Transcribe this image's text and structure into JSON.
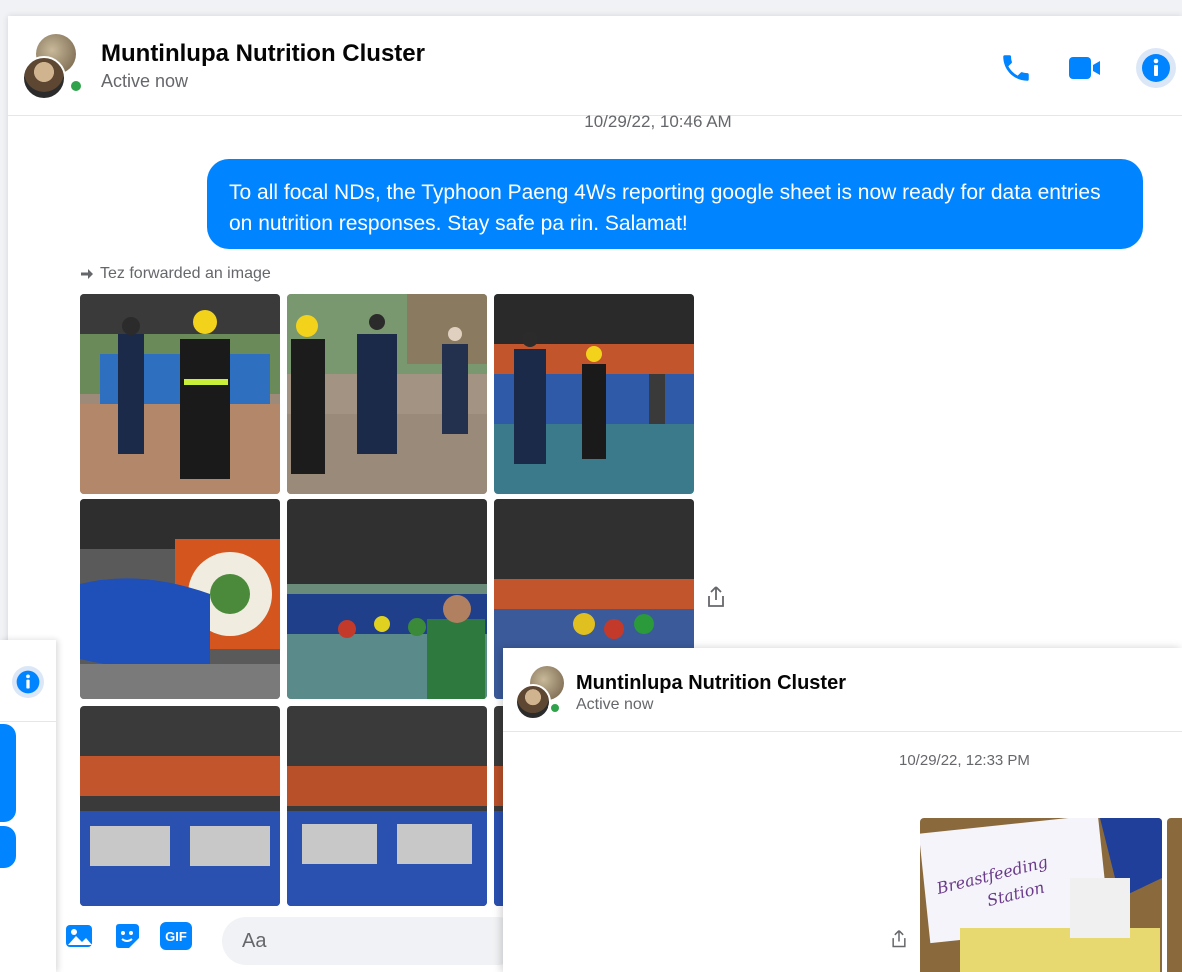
{
  "main_window": {
    "title": "Muntinlupa Nutrition Cluster",
    "status": "Active now",
    "timestamp": "10/29/22, 10:46 AM",
    "message": "To all focal NDs, the Typhoon Paeng 4Ws reporting google sheet is now ready for data entries on nutrition responses. Stay safe pa rin. Salamat!",
    "forwarded_label": "Tez forwarded an image",
    "icons": [
      "phone-icon",
      "video-icon",
      "info-icon",
      "share-icon"
    ],
    "composer": {
      "placeholder": "Aa",
      "gif_label": "GIF"
    }
  },
  "overlay_window": {
    "title": "Muntinlupa Nutrition Cluster",
    "status": "Active now",
    "timestamp": "10/29/22, 12:33 PM",
    "photo_caption_line1": "Breastfeeding",
    "photo_caption_line2": "Station"
  },
  "colors": {
    "accent": "#0084ff",
    "online": "#31a24c",
    "muted_text": "#65676b"
  }
}
